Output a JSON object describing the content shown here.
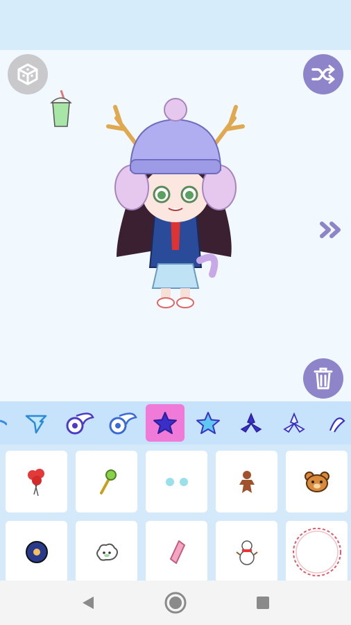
{
  "app": {
    "icons": {
      "top_left": "cube-icon",
      "top_right": "shuffle-icon",
      "delete": "trash-icon",
      "next": "double-chevron-right-icon"
    },
    "colors": {
      "topbar": "#d7ecfb",
      "canvas": "#f1f9fe",
      "button_purple": "#8d84c9",
      "button_gray": "#c9c9cc",
      "tab_active": "#f07ad8",
      "tab_bar": "#c6e3fb",
      "grid_bg": "#d4eafb"
    }
  },
  "category_tabs": [
    {
      "icon": "wing-partial-icon"
    },
    {
      "icon": "blue-wing-icon"
    },
    {
      "icon": "purple-wing-circle-icon"
    },
    {
      "icon": "white-wing-circle-icon"
    },
    {
      "icon": "purple-star-icon",
      "selected": true
    },
    {
      "icon": "blue-star-icon"
    },
    {
      "icon": "purple-trefoil-icon"
    },
    {
      "icon": "white-trefoil-icon"
    },
    {
      "icon": "swirl-icon"
    }
  ],
  "items": [
    {
      "icon": "red-balloons-icon"
    },
    {
      "icon": "green-wand-icon"
    },
    {
      "icon": "blue-dots-icon"
    },
    {
      "icon": "gingerbread-man-icon"
    },
    {
      "icon": "bear-face-icon"
    },
    {
      "icon": "donut-icon"
    },
    {
      "icon": "cloud-sheep-icon"
    },
    {
      "icon": "pink-crystal-icon"
    },
    {
      "icon": "snowman-icon"
    },
    {
      "icon": "lace-ring-icon"
    }
  ],
  "navigation": {
    "back": "back-triangle-icon",
    "home": "home-circle-icon",
    "recents": "recents-square-icon"
  }
}
